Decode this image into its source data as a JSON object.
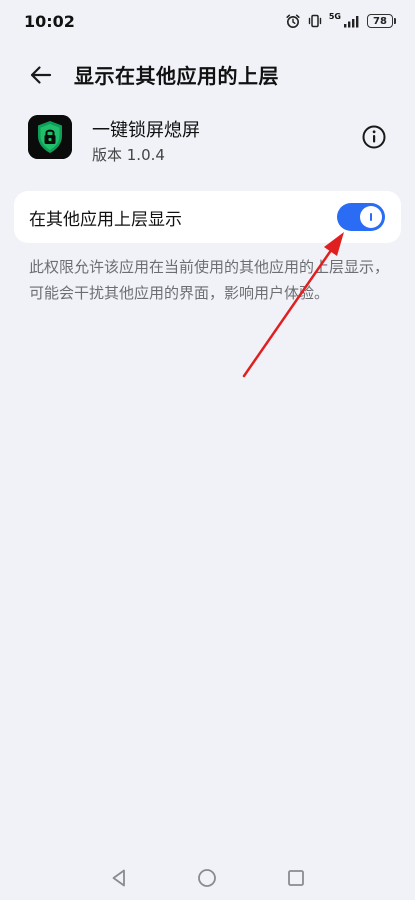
{
  "status_bar": {
    "time": "10:02",
    "network": "5G",
    "battery": "78",
    "icons": [
      "alarm-icon",
      "vibrate-icon",
      "signal-icon",
      "battery-icon"
    ]
  },
  "header": {
    "title": "显示在其他应用的上层",
    "back_icon": "back-arrow-icon"
  },
  "app": {
    "name": "一键锁屏熄屏",
    "version": "版本 1.0.4",
    "icon": "lock-shield-app-icon",
    "info_icon": "info-icon"
  },
  "setting": {
    "label": "在其他应用上层显示",
    "enabled": true,
    "toggle_color": "#2a6df4"
  },
  "description": "此权限允许该应用在当前使用的其他应用的上层显示，可能会干扰其他应用的界面，影响用户体验。",
  "annotation": {
    "color": "#e02020",
    "icon": "red-arrow-annotation"
  },
  "nav_bar": {
    "icons": [
      "nav-back-icon",
      "nav-home-icon",
      "nav-recent-icon"
    ]
  }
}
